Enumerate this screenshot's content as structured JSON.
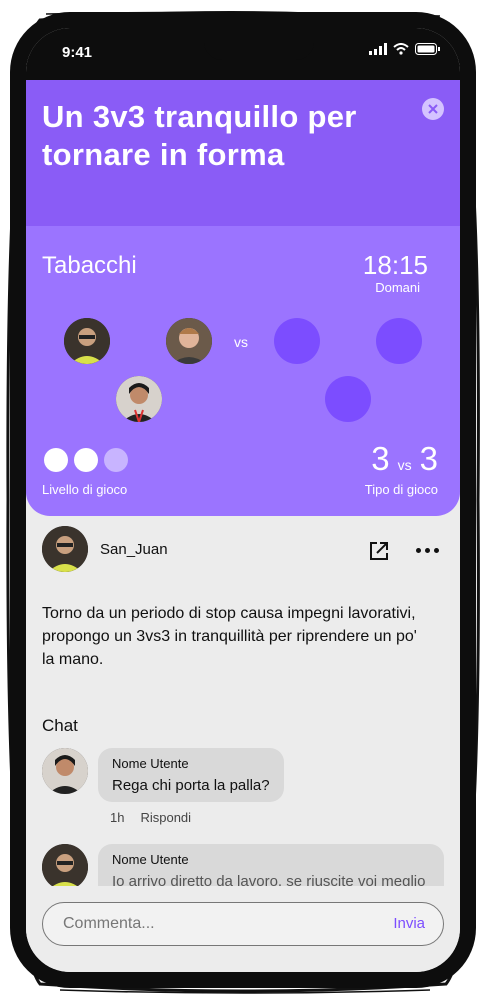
{
  "status": {
    "time": "9:41"
  },
  "event": {
    "title": "Un 3v3 tranquillo per tornare in forma",
    "place": "Tabacchi",
    "hour": "18:15",
    "day": "Domani",
    "vs": "vs",
    "level_label": "Livello di gioco",
    "level": {
      "filled": 2,
      "total": 3
    },
    "team_a": "3",
    "team_b": "3",
    "type_label": "Tipo di gioco"
  },
  "post": {
    "author": "San_Juan",
    "text": "Torno da un periodo di stop causa impegni lavorativi, propongo un 3vs3 in tranquillità per riprendere un po' la mano."
  },
  "chat": {
    "title": "Chat",
    "messages": [
      {
        "user": "Nome Utente",
        "text": "Rega chi porta la palla?",
        "time": "1h",
        "reply": "Rispondi"
      },
      {
        "user": "Nome Utente",
        "text": "Io arrivo diretto da lavoro, se riuscite voi meglio"
      }
    ]
  },
  "composer": {
    "placeholder": "Commenta...",
    "send": "Invia"
  },
  "colors": {
    "accent": "#8a5cf6",
    "card": "#9b74ff",
    "slot": "#7c4dff"
  }
}
